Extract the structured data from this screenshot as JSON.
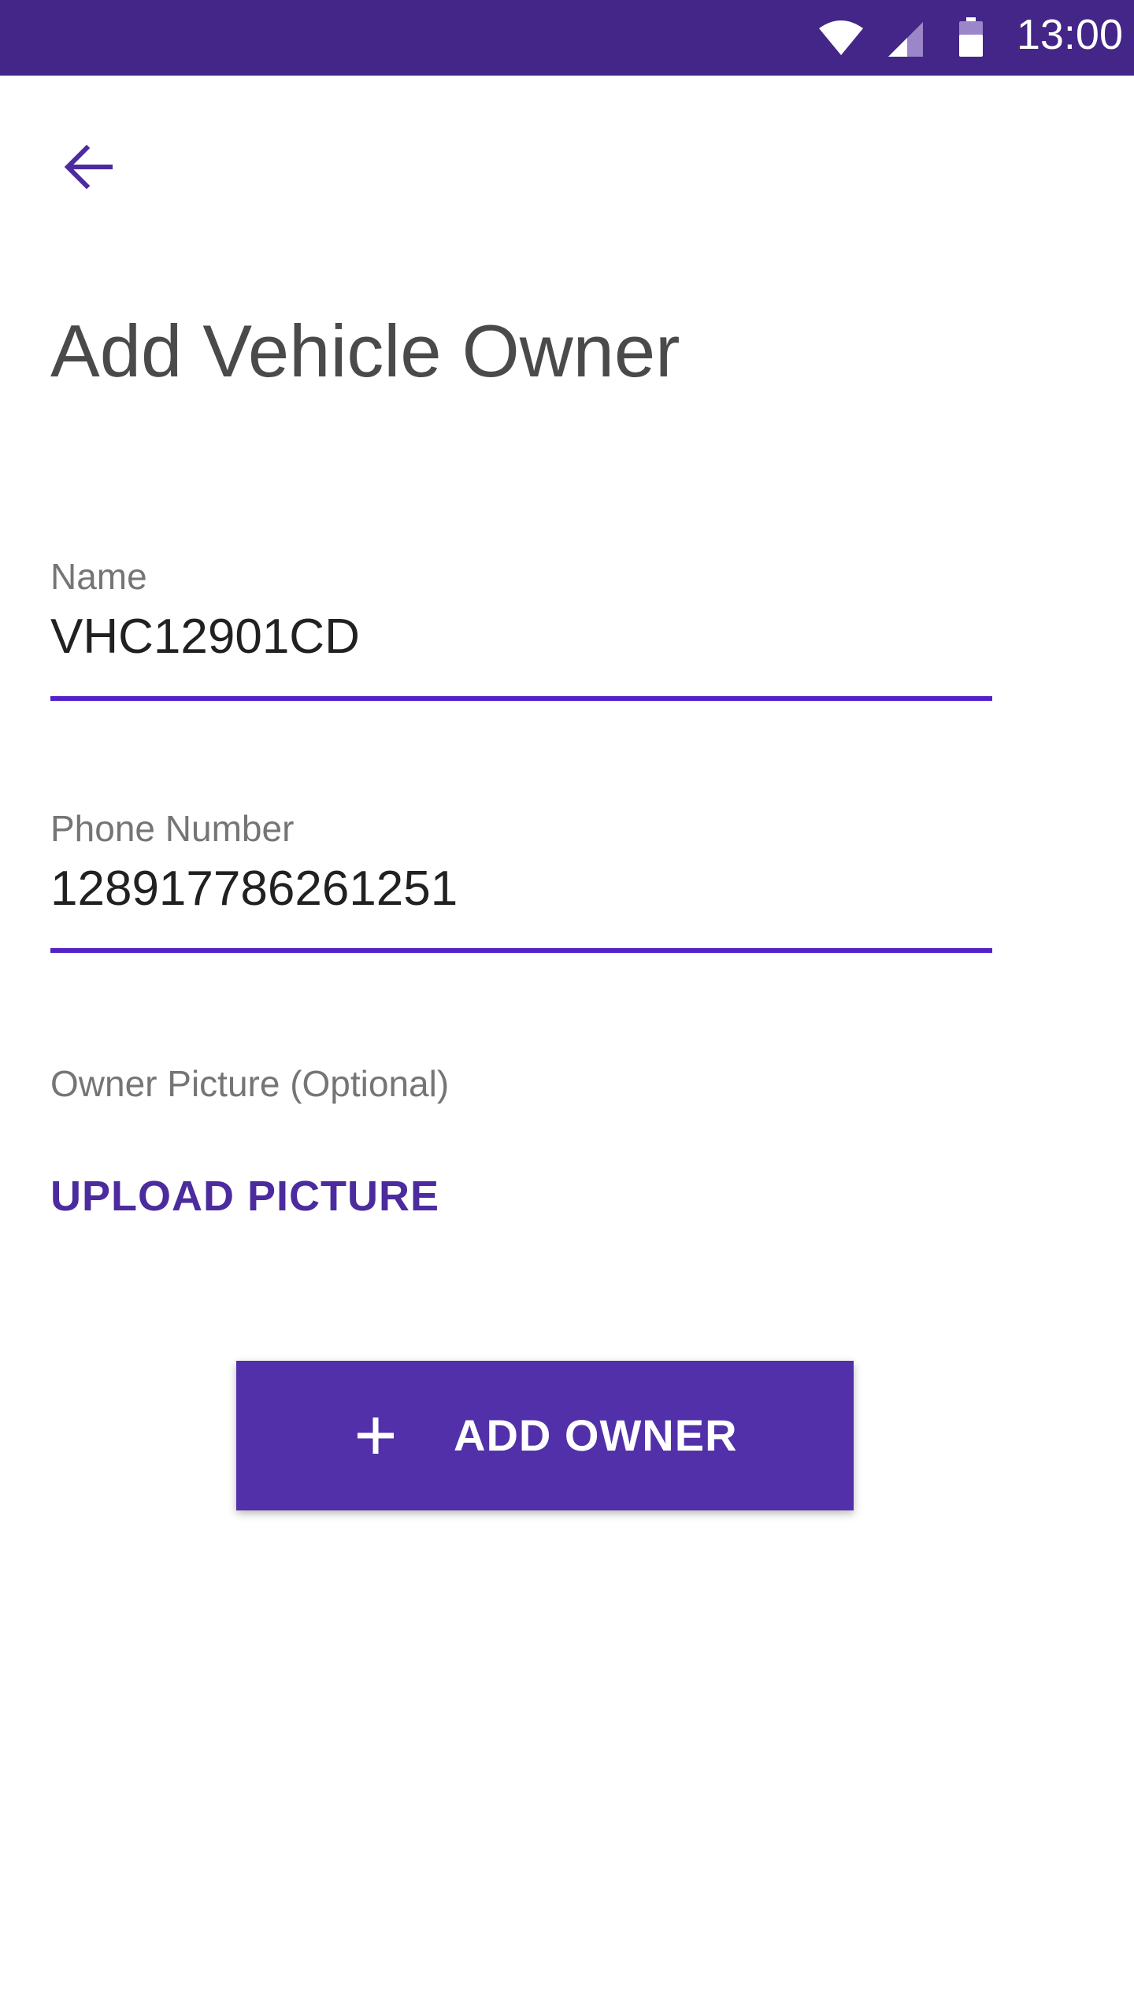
{
  "status_bar": {
    "time": "13:00",
    "icons": [
      "wifi-icon",
      "signal-icon",
      "battery-icon"
    ],
    "background": "#432687"
  },
  "nav": {
    "back_icon": "arrow-left-icon"
  },
  "page": {
    "title": "Add Vehicle Owner"
  },
  "form": {
    "name": {
      "label": "Name",
      "value": "VHC12901CD"
    },
    "phone": {
      "label": "Phone Number",
      "value": "128917786261251"
    },
    "picture": {
      "label": "Owner Picture (Optional)",
      "upload_label": "UPLOAD PICTURE"
    }
  },
  "actions": {
    "add_owner_label": "ADD OWNER",
    "add_owner_icon": "plus-icon"
  },
  "colors": {
    "primary": "#5230a9",
    "accent_underline": "#5321c9",
    "status_bar": "#432687",
    "title_text": "#4a4a4a",
    "label_text": "#757575"
  }
}
